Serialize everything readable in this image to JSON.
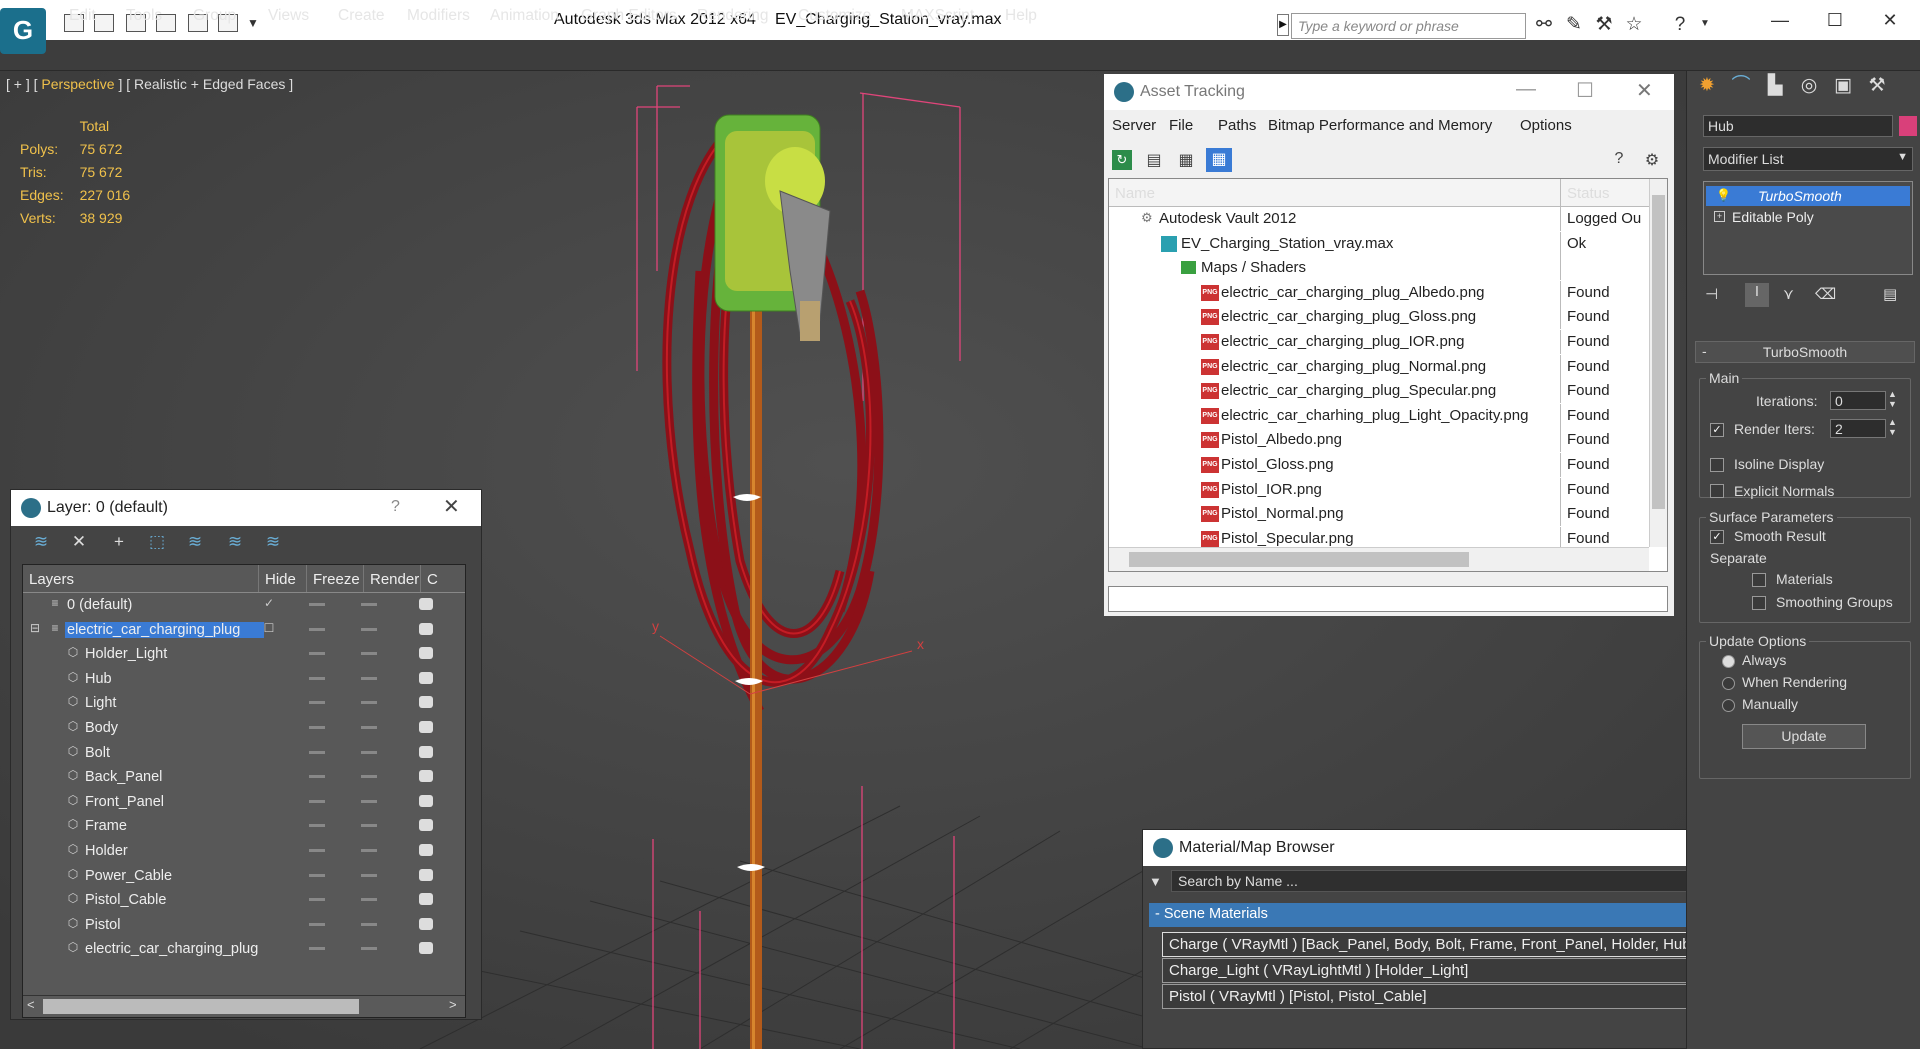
{
  "titlebar": {
    "app_title": "Autodesk 3ds Max  2012 x64",
    "file_name": "EV_Charging_Station_vray.max",
    "search_placeholder": "Type a keyword or phrase"
  },
  "menu": [
    "Edit",
    "Tools",
    "Group",
    "Views",
    "Create",
    "Modifiers",
    "Animation",
    "Graph Editors",
    "Rendering",
    "Customize",
    "MAXScript",
    "Help"
  ],
  "viewport": {
    "label_prefix": "[ + ] [",
    "label_view": " Perspective ",
    "label_suffix": "] [ Realistic + Edged Faces ]",
    "stats_header": "Total",
    "stats": [
      {
        "label": "Polys:",
        "value": "75 672"
      },
      {
        "label": "Tris:",
        "value": "75 672"
      },
      {
        "label": "Edges:",
        "value": "227 016"
      },
      {
        "label": "Verts:",
        "value": "38 929"
      }
    ],
    "axis_x": "x",
    "axis_y": "y"
  },
  "layer_panel": {
    "title": "Layer: 0 (default)",
    "help": "?",
    "columns": [
      "Layers",
      "Hide",
      "Freeze",
      "Render"
    ],
    "rows": [
      {
        "name": "0 (default)",
        "level": 0
      },
      {
        "name": "electric_car_charging_plug",
        "level": 0
      },
      {
        "name": "Holder_Light",
        "level": 1
      },
      {
        "name": "Hub",
        "level": 1
      },
      {
        "name": "Light",
        "level": 1
      },
      {
        "name": "Body",
        "level": 1
      },
      {
        "name": "Bolt",
        "level": 1
      },
      {
        "name": "Back_Panel",
        "level": 1
      },
      {
        "name": "Front_Panel",
        "level": 1
      },
      {
        "name": "Frame",
        "level": 1
      },
      {
        "name": "Holder",
        "level": 1
      },
      {
        "name": "Power_Cable",
        "level": 1
      },
      {
        "name": "Pistol_Cable",
        "level": 1
      },
      {
        "name": "Pistol",
        "level": 1
      },
      {
        "name": "electric_car_charging_plug",
        "level": 1
      }
    ]
  },
  "asset_tracking": {
    "title": "Asset Tracking",
    "menu": [
      "Server",
      "File",
      "Paths",
      "Bitmap Performance and Memory",
      "Options"
    ],
    "columns": [
      "Name",
      "Status"
    ],
    "rows": [
      {
        "name": "Autodesk Vault 2012",
        "status": "Logged Ou"
      },
      {
        "name": "EV_Charging_Station_vray.max",
        "status": "Ok"
      },
      {
        "name": "Maps / Shaders",
        "status": ""
      },
      {
        "name": "electric_car_charging_plug_Albedo.png",
        "status": "Found"
      },
      {
        "name": "electric_car_charging_plug_Gloss.png",
        "status": "Found"
      },
      {
        "name": "electric_car_charging_plug_IOR.png",
        "status": "Found"
      },
      {
        "name": "electric_car_charging_plug_Normal.png",
        "status": "Found"
      },
      {
        "name": "electric_car_charging_plug_Specular.png",
        "status": "Found"
      },
      {
        "name": "electric_car_charhing_plug_Light_Opacity.png",
        "status": "Found"
      },
      {
        "name": "Pistol_Albedo.png",
        "status": "Found"
      },
      {
        "name": "Pistol_Gloss.png",
        "status": "Found"
      },
      {
        "name": "Pistol_IOR.png",
        "status": "Found"
      },
      {
        "name": "Pistol_Normal.png",
        "status": "Found"
      },
      {
        "name": "Pistol_Specular.png",
        "status": "Found"
      }
    ]
  },
  "material_browser": {
    "title": "Material/Map Browser",
    "search_placeholder": "Search by Name ...",
    "section": "Scene Materials",
    "items": [
      "Charge  ( VRayMtl )  [Back_Panel, Body, Bolt, Frame, Front_Panel, Holder, Hub, Light, Power_Cable]",
      "Charge_Light  ( VRayLightMtl )  [Holder_Light]",
      "Pistol  ( VRayMtl )  [Pistol, Pistol_Cable]"
    ]
  },
  "command_panel": {
    "object_name": "Hub",
    "object_color": "#d9407a",
    "modifier_list_label": "Modifier List",
    "stack": [
      "TurboSmooth",
      "Editable Poly"
    ],
    "rollout_title": "TurboSmooth",
    "main_group": "Main",
    "iterations_label": "Iterations:",
    "iterations_value": "0",
    "render_iters_label": "Render Iters:",
    "render_iters_value": "2",
    "render_iters_checked": true,
    "isoline_label": "Isoline Display",
    "explicit_normals_label": "Explicit Normals",
    "surface_group": "Surface Parameters",
    "smooth_result_label": "Smooth Result",
    "smooth_result_checked": true,
    "separate_label": "Separate",
    "materials_label": "Materials",
    "smoothing_groups_label": "Smoothing Groups",
    "update_group": "Update Options",
    "always_label": "Always",
    "when_rendering_label": "When Rendering",
    "manually_label": "Manually",
    "update_button": "Update"
  },
  "colors": {
    "selection_blue": "#3a7bd5",
    "stats_yellow": "#f0c14b",
    "cable_red": "#a0121a",
    "bbox_pink": "#e0457a"
  }
}
